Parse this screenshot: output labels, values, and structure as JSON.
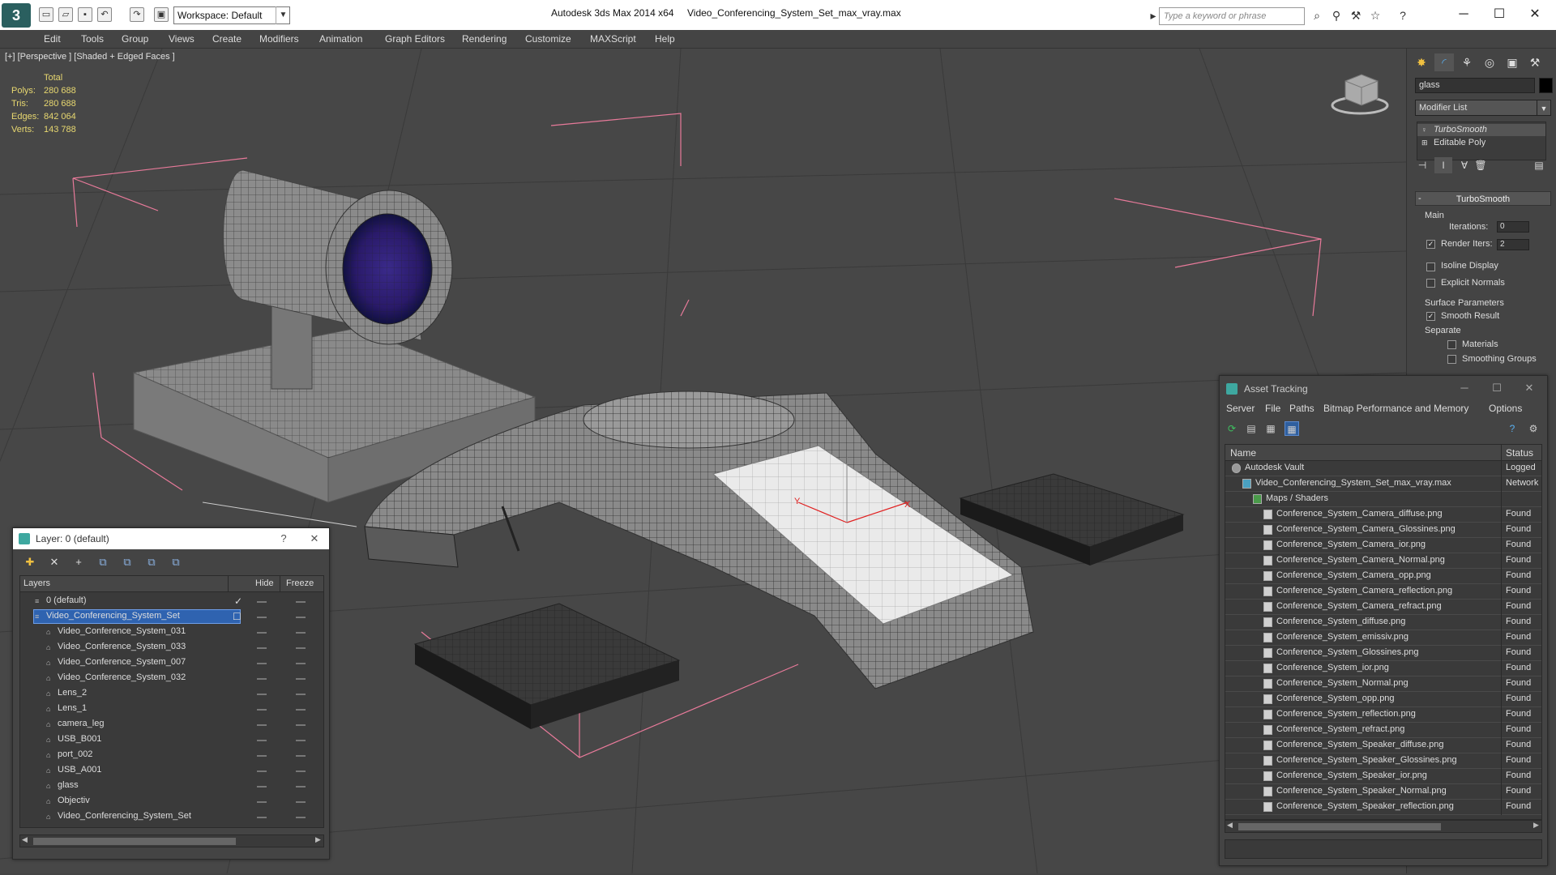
{
  "titlebar": {
    "workspace": "Workspace: Default",
    "app_title": "Autodesk 3ds Max  2014 x64",
    "file_title": "Video_Conferencing_System_Set_max_vray.max",
    "search_placeholder": "Type a keyword or phrase"
  },
  "menu": [
    "Edit",
    "Tools",
    "Group",
    "Views",
    "Create",
    "Modifiers",
    "Animation",
    "Graph Editors",
    "Rendering",
    "Customize",
    "MAXScript",
    "Help"
  ],
  "viewport": {
    "label": "[+] [Perspective ] [Shaded + Edged Faces ]",
    "stats_header": "Total",
    "stats": [
      {
        "name": "Polys:",
        "value": "280 688"
      },
      {
        "name": "Tris:",
        "value": "280 688"
      },
      {
        "name": "Edges:",
        "value": "842 064"
      },
      {
        "name": "Verts:",
        "value": "143 788"
      }
    ],
    "axis_y": "Y",
    "axis_x": "X"
  },
  "command_panel": {
    "object_name": "glass",
    "modifier_list": "Modifier List",
    "stack": [
      "TurboSmooth",
      "Editable Poly"
    ],
    "rollout_title": "TurboSmooth",
    "main_label": "Main",
    "iterations_label": "Iterations:",
    "iterations_value": "0",
    "render_iters_label": "Render Iters:",
    "render_iters_value": "2",
    "isoline_label": "Isoline Display",
    "explicit_label": "Explicit Normals",
    "surface_label": "Surface Parameters",
    "smooth_label": "Smooth Result",
    "separate_label": "Separate",
    "materials_label": "Materials",
    "smoothing_label": "Smoothing Groups"
  },
  "asset_tracking": {
    "title": "Asset Tracking",
    "menu": [
      "Server",
      "File",
      "Paths",
      "Bitmap Performance and Memory",
      "Options"
    ],
    "col_name": "Name",
    "col_status": "Status",
    "rows": [
      {
        "name": "Autodesk Vault",
        "status": "Logged",
        "indent": 0
      },
      {
        "name": "Video_Conferencing_System_Set_max_vray.max",
        "status": "Network",
        "indent": 1
      },
      {
        "name": "Maps / Shaders",
        "status": "",
        "indent": 2
      },
      {
        "name": "Conference_System_Camera_diffuse.png",
        "status": "Found",
        "indent": 3
      },
      {
        "name": "Conference_System_Camera_Glossines.png",
        "status": "Found",
        "indent": 3
      },
      {
        "name": "Conference_System_Camera_ior.png",
        "status": "Found",
        "indent": 3
      },
      {
        "name": "Conference_System_Camera_Normal.png",
        "status": "Found",
        "indent": 3
      },
      {
        "name": "Conference_System_Camera_opp.png",
        "status": "Found",
        "indent": 3
      },
      {
        "name": "Conference_System_Camera_reflection.png",
        "status": "Found",
        "indent": 3
      },
      {
        "name": "Conference_System_Camera_refract.png",
        "status": "Found",
        "indent": 3
      },
      {
        "name": "Conference_System_diffuse.png",
        "status": "Found",
        "indent": 3
      },
      {
        "name": "Conference_System_emissiv.png",
        "status": "Found",
        "indent": 3
      },
      {
        "name": "Conference_System_Glossines.png",
        "status": "Found",
        "indent": 3
      },
      {
        "name": "Conference_System_ior.png",
        "status": "Found",
        "indent": 3
      },
      {
        "name": "Conference_System_Normal.png",
        "status": "Found",
        "indent": 3
      },
      {
        "name": "Conference_System_opp.png",
        "status": "Found",
        "indent": 3
      },
      {
        "name": "Conference_System_reflection.png",
        "status": "Found",
        "indent": 3
      },
      {
        "name": "Conference_System_refract.png",
        "status": "Found",
        "indent": 3
      },
      {
        "name": "Conference_System_Speaker_diffuse.png",
        "status": "Found",
        "indent": 3
      },
      {
        "name": "Conference_System_Speaker_Glossines.png",
        "status": "Found",
        "indent": 3
      },
      {
        "name": "Conference_System_Speaker_ior.png",
        "status": "Found",
        "indent": 3
      },
      {
        "name": "Conference_System_Speaker_Normal.png",
        "status": "Found",
        "indent": 3
      },
      {
        "name": "Conference_System_Speaker_reflection.png",
        "status": "Found",
        "indent": 3
      }
    ]
  },
  "layers": {
    "title": "Layer: 0 (default)",
    "col_layers": "Layers",
    "col_hide": "Hide",
    "col_freeze": "Freeze",
    "rows": [
      {
        "name": "0 (default)",
        "level": 0,
        "check": true
      },
      {
        "name": "Video_Conferencing_System_Set",
        "level": 0,
        "selected": true
      },
      {
        "name": "Video_Conference_System_031",
        "level": 1
      },
      {
        "name": "Video_Conference_System_033",
        "level": 1
      },
      {
        "name": "Video_Conference_System_007",
        "level": 1
      },
      {
        "name": "Video_Conference_System_032",
        "level": 1
      },
      {
        "name": "Lens_2",
        "level": 1
      },
      {
        "name": "Lens_1",
        "level": 1
      },
      {
        "name": "camera_leg",
        "level": 1
      },
      {
        "name": "USB_B001",
        "level": 1
      },
      {
        "name": "port_002",
        "level": 1
      },
      {
        "name": "USB_A001",
        "level": 1
      },
      {
        "name": "glass",
        "level": 1
      },
      {
        "name": "Objectiv",
        "level": 1
      },
      {
        "name": "Video_Conferencing_System_Set",
        "level": 1
      }
    ]
  }
}
